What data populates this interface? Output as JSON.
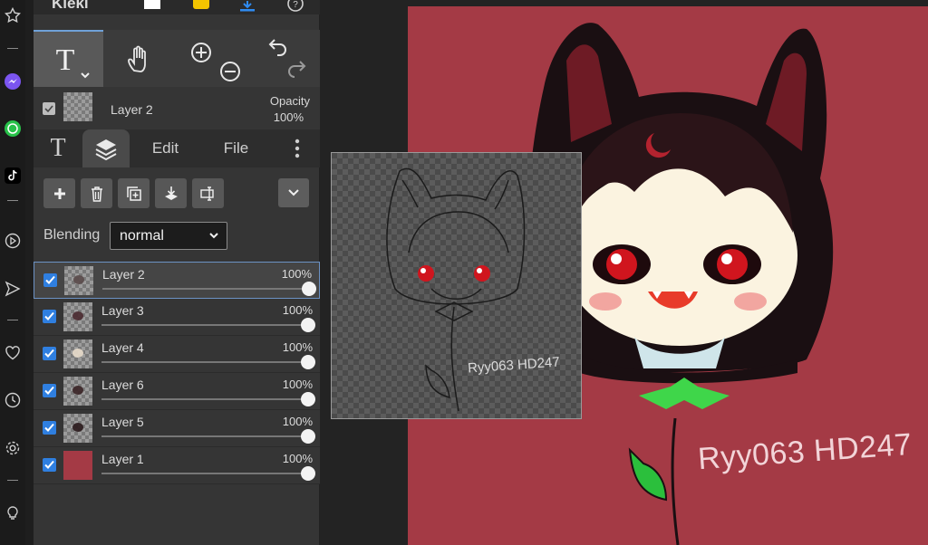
{
  "app": {
    "brand": "Kleki"
  },
  "layer_info": {
    "name": "Layer 2",
    "opacity_label": "Opacity",
    "opacity_value": "100%"
  },
  "tabs": [
    {
      "label": "T"
    },
    {
      "label": "Layers"
    },
    {
      "label": "Edit"
    },
    {
      "label": "File"
    }
  ],
  "blending": {
    "label": "Blending",
    "value": "normal"
  },
  "layers": [
    {
      "name": "Layer 2",
      "opacity": "100%",
      "selected": true
    },
    {
      "name": "Layer 3",
      "opacity": "100%"
    },
    {
      "name": "Layer 4",
      "opacity": "100%"
    },
    {
      "name": "Layer 6",
      "opacity": "100%"
    },
    {
      "name": "Layer 5",
      "opacity": "100%"
    },
    {
      "name": "Layer 1",
      "opacity": "100%"
    }
  ],
  "canvas": {
    "background_color": "#a43a45",
    "watermark": "Ryy063 HD247",
    "preview_watermark": "Ryy063 HD247"
  },
  "colors": {
    "accent": "#2f7fe0",
    "panel": "#353535"
  }
}
